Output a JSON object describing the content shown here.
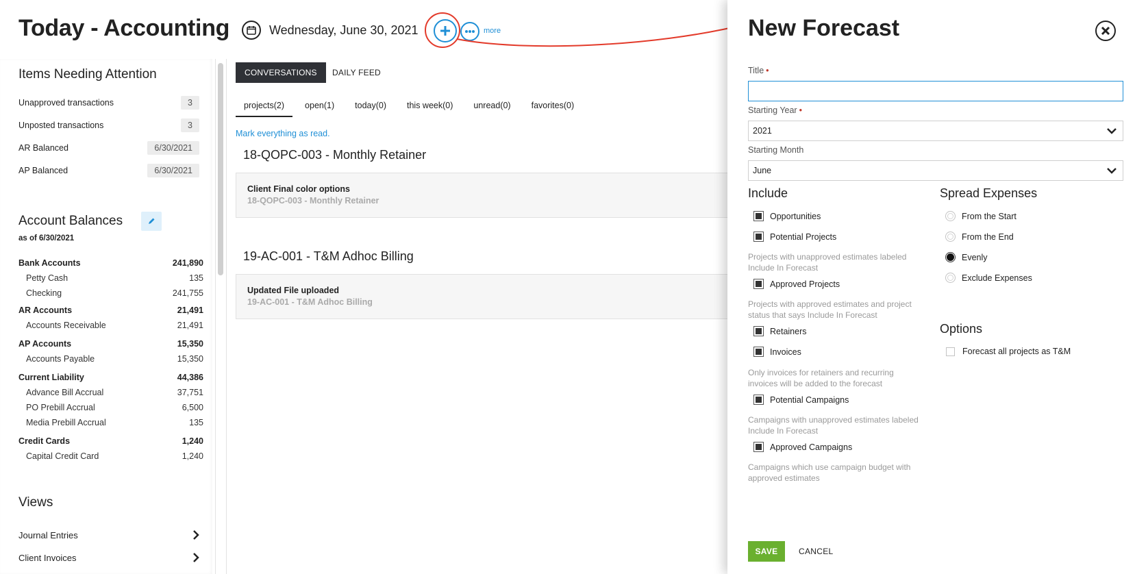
{
  "page": {
    "title": "Today - Accounting",
    "date": "Wednesday, June 30, 2021",
    "more_label": "more"
  },
  "attention": {
    "title": "Items Needing Attention",
    "items": [
      {
        "label": "Unapproved transactions",
        "value": "3"
      },
      {
        "label": "Unposted transactions",
        "value": "3"
      },
      {
        "label": "AR Balanced",
        "value": "6/30/2021"
      },
      {
        "label": "AP Balanced",
        "value": "6/30/2021"
      }
    ]
  },
  "balances": {
    "title": "Account Balances",
    "as_of": "as of 6/30/2021",
    "rows": [
      {
        "label": "Bank Accounts",
        "value": "241,890"
      },
      {
        "label": "Petty Cash",
        "value": "135"
      },
      {
        "label": "Checking",
        "value": "241,755"
      },
      {
        "label": "AR Accounts",
        "value": "21,491"
      },
      {
        "label": "Accounts Receivable",
        "value": "21,491"
      },
      {
        "label": "AP Accounts",
        "value": "15,350"
      },
      {
        "label": "Accounts Payable",
        "value": "15,350"
      },
      {
        "label": "Current Liability",
        "value": "44,386"
      },
      {
        "label": "Advance Bill Accrual",
        "value": "37,751"
      },
      {
        "label": "PO Prebill Accrual",
        "value": "6,500"
      },
      {
        "label": "Media Prebill Accrual",
        "value": "135"
      },
      {
        "label": "Credit Cards",
        "value": "1,240"
      },
      {
        "label": "Capital Credit Card",
        "value": "1,240"
      }
    ]
  },
  "views": {
    "title": "Views",
    "items": [
      "Journal Entries",
      "Client Invoices"
    ]
  },
  "tabs": {
    "conversations": "CONVERSATIONS",
    "daily_feed": "DAILY FEED"
  },
  "filters": [
    "projects(2)",
    "open(1)",
    "today(0)",
    "this week(0)",
    "unread(0)",
    "favorites(0)"
  ],
  "mark_read": "Mark everything as read.",
  "projects": [
    {
      "title": "18-QOPC-003 - Monthly Retainer",
      "card_title": "Client Final color options",
      "card_sub": "18-QOPC-003 - Monthly Retainer"
    },
    {
      "title": "19-AC-001 - T&M Adhoc Billing",
      "card_title": "Updated File uploaded",
      "card_sub": "19-AC-001 - T&M Adhoc Billing"
    }
  ],
  "forecast": {
    "title": "New Forecast",
    "title_label": "Title",
    "title_value": "",
    "starting_year_label": "Starting Year",
    "starting_year_value": "2021",
    "starting_month_label": "Starting Month",
    "starting_month_value": "June",
    "include_title": "Include",
    "include": {
      "opportunities": "Opportunities",
      "potential_projects": "Potential Projects",
      "potential_projects_help": "Projects with unapproved estimates labeled Include In Forecast",
      "approved_projects": "Approved Projects",
      "approved_projects_help": "Projects with approved estimates and project status that says Include In Forecast",
      "retainers": "Retainers",
      "invoices": "Invoices",
      "invoices_help": "Only invoices for retainers and recurring invoices will be added to the forecast",
      "potential_campaigns": "Potential Campaigns",
      "potential_campaigns_help": "Campaigns with unapproved estimates labeled Include In Forecast",
      "approved_campaigns": "Approved Campaigns",
      "approved_campaigns_help": "Campaigns which use campaign budget with approved estimates"
    },
    "spread_title": "Spread Expenses",
    "spread": {
      "from_start": "From the Start",
      "from_end": "From the End",
      "evenly": "Evenly",
      "exclude": "Exclude Expenses",
      "selected": "Evenly"
    },
    "options_title": "Options",
    "options": {
      "tm": "Forecast all projects as T&M"
    },
    "save": "SAVE",
    "cancel": "CANCEL"
  },
  "colors": {
    "accent": "#1f8fd6",
    "highlight": "#e33a2a",
    "save": "#6ab02f"
  }
}
